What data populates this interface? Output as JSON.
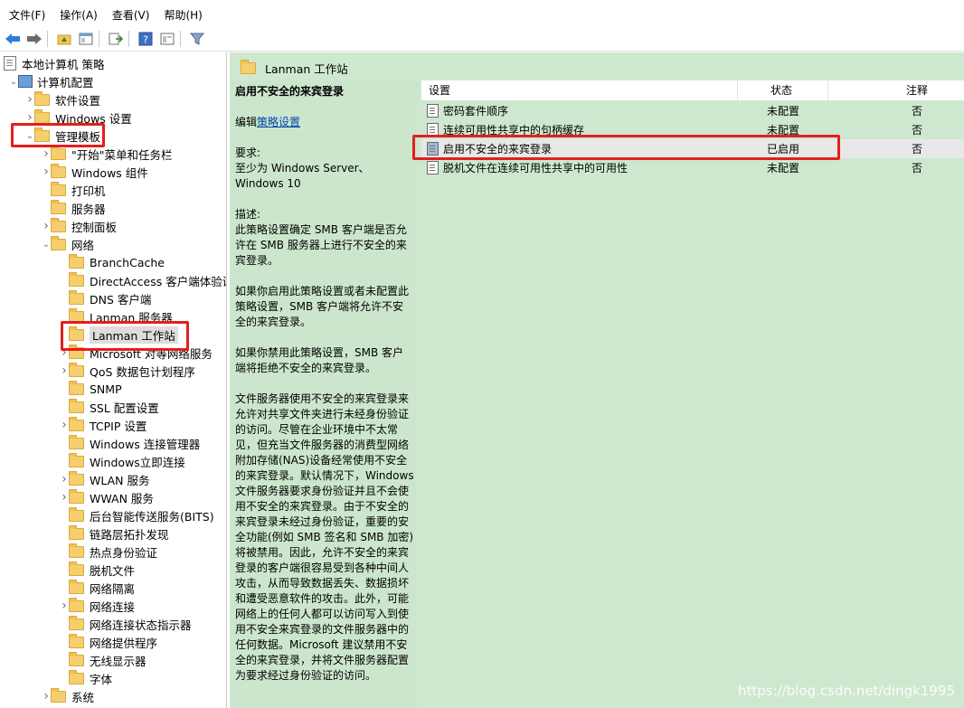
{
  "menu": [
    {
      "label": "文件(F)"
    },
    {
      "label": "操作(A)"
    },
    {
      "label": "查看(V)"
    },
    {
      "label": "帮助(H)"
    }
  ],
  "toolbar": [
    {
      "icon": "back-arrow-icon"
    },
    {
      "icon": "forward-arrow-icon"
    },
    {
      "icon": "up-folder-icon"
    },
    {
      "icon": "show-tree-icon"
    },
    {
      "icon": "export-list-icon"
    },
    {
      "icon": "help-icon"
    },
    {
      "icon": "properties-icon"
    },
    {
      "icon": "filter-icon"
    }
  ],
  "tree": {
    "items": [
      {
        "label": "本地计算机 策略",
        "level": 0,
        "arrow": "",
        "icon": "doc"
      },
      {
        "label": "计算机配置",
        "level": 1,
        "arrow": "down",
        "icon": "computer"
      },
      {
        "label": "软件设置",
        "level": 2,
        "arrow": "right",
        "icon": "folder"
      },
      {
        "label": "Windows 设置",
        "level": 2,
        "arrow": "right",
        "icon": "folder"
      },
      {
        "label": "管理模板",
        "level": 2,
        "arrow": "down",
        "icon": "folder"
      },
      {
        "label": "\"开始\"菜单和任务栏",
        "level": 3,
        "arrow": "right",
        "icon": "folder"
      },
      {
        "label": "Windows 组件",
        "level": 3,
        "arrow": "right",
        "icon": "folder"
      },
      {
        "label": "打印机",
        "level": 3,
        "arrow": "",
        "icon": "folder"
      },
      {
        "label": "服务器",
        "level": 3,
        "arrow": "",
        "icon": "folder"
      },
      {
        "label": "控制面板",
        "level": 3,
        "arrow": "right",
        "icon": "folder"
      },
      {
        "label": "网络",
        "level": 3,
        "arrow": "down",
        "icon": "folder"
      },
      {
        "label": "BranchCache",
        "level": 4,
        "arrow": "",
        "icon": "folder"
      },
      {
        "label": "DirectAccess 客户端体验设置",
        "level": 4,
        "arrow": "",
        "icon": "folder"
      },
      {
        "label": "DNS 客户端",
        "level": 4,
        "arrow": "",
        "icon": "folder"
      },
      {
        "label": "Lanman 服务器",
        "level": 4,
        "arrow": "",
        "icon": "folder"
      },
      {
        "label": "Lanman 工作站",
        "level": 4,
        "arrow": "",
        "icon": "folder",
        "selected": true
      },
      {
        "label": "Microsoft 对等网络服务",
        "level": 4,
        "arrow": "right",
        "icon": "folder"
      },
      {
        "label": "QoS 数据包计划程序",
        "level": 4,
        "arrow": "right",
        "icon": "folder"
      },
      {
        "label": "SNMP",
        "level": 4,
        "arrow": "",
        "icon": "folder"
      },
      {
        "label": "SSL 配置设置",
        "level": 4,
        "arrow": "",
        "icon": "folder"
      },
      {
        "label": "TCPIP 设置",
        "level": 4,
        "arrow": "right",
        "icon": "folder"
      },
      {
        "label": "Windows 连接管理器",
        "level": 4,
        "arrow": "",
        "icon": "folder"
      },
      {
        "label": "Windows立即连接",
        "level": 4,
        "arrow": "",
        "icon": "folder"
      },
      {
        "label": "WLAN 服务",
        "level": 4,
        "arrow": "right",
        "icon": "folder"
      },
      {
        "label": "WWAN 服务",
        "level": 4,
        "arrow": "right",
        "icon": "folder"
      },
      {
        "label": "后台智能传送服务(BITS)",
        "level": 4,
        "arrow": "",
        "icon": "folder"
      },
      {
        "label": "链路层拓扑发现",
        "level": 4,
        "arrow": "",
        "icon": "folder"
      },
      {
        "label": "热点身份验证",
        "level": 4,
        "arrow": "",
        "icon": "folder"
      },
      {
        "label": "脱机文件",
        "level": 4,
        "arrow": "",
        "icon": "folder"
      },
      {
        "label": "网络隔离",
        "level": 4,
        "arrow": "",
        "icon": "folder"
      },
      {
        "label": "网络连接",
        "level": 4,
        "arrow": "right",
        "icon": "folder"
      },
      {
        "label": "网络连接状态指示器",
        "level": 4,
        "arrow": "",
        "icon": "folder"
      },
      {
        "label": "网络提供程序",
        "level": 4,
        "arrow": "",
        "icon": "folder"
      },
      {
        "label": "无线显示器",
        "level": 4,
        "arrow": "",
        "icon": "folder"
      },
      {
        "label": "字体",
        "level": 4,
        "arrow": "",
        "icon": "folder"
      },
      {
        "label": "系统",
        "level": 3,
        "arrow": "right",
        "icon": "folder"
      }
    ]
  },
  "pane": {
    "title": "Lanman 工作站"
  },
  "description": {
    "title": "启用不安全的来宾登录",
    "edit_prefix": "编辑",
    "edit_link": "策略设置",
    "requirements_label": "要求:",
    "requirements_text": "至少为 Windows Server、Windows 10",
    "desc_label": "描述:",
    "para1": "此策略设置确定 SMB 客户端是否允许在 SMB 服务器上进行不安全的来宾登录。",
    "para2": "如果你启用此策略设置或者未配置此策略设置，SMB 客户端将允许不安全的来宾登录。",
    "para3": "如果你禁用此策略设置，SMB 客户端将拒绝不安全的来宾登录。",
    "para4": "文件服务器使用不安全的来宾登录来允许对共享文件夹进行未经身份验证的访问。尽管在企业环境中不太常见，但充当文件服务器的消费型网络附加存储(NAS)设备经常使用不安全的来宾登录。默认情况下，Windows 文件服务器要求身份验证并且不会使用不安全的来宾登录。由于不安全的来宾登录未经过身份验证，重要的安全功能(例如 SMB 签名和 SMB 加密)将被禁用。因此，允许不安全的来宾登录的客户端很容易受到各种中间人攻击，从而导致数据丢失、数据损坏和遭受恶意软件的攻击。此外，可能网络上的任何人都可以访问写入到使用不安全来宾登录的文件服务器中的任何数据。Microsoft 建议禁用不安全的来宾登录，并将文件服务器配置为要求经过身份验证的访问。"
  },
  "list": {
    "headers": {
      "setting": "设置",
      "state": "状态",
      "comment": "注释"
    },
    "rows": [
      {
        "name": "密码套件顺序",
        "state": "未配置",
        "comment": "否",
        "enabled": false
      },
      {
        "name": "连续可用性共享中的句柄缓存",
        "state": "未配置",
        "comment": "否",
        "enabled": false
      },
      {
        "name": "启用不安全的来宾登录",
        "state": "已启用",
        "comment": "否",
        "enabled": true
      },
      {
        "name": "脱机文件在连续可用性共享中的可用性",
        "state": "未配置",
        "comment": "否",
        "enabled": false
      }
    ]
  },
  "watermark": "https://blog.csdn.net/dingk1995",
  "colors": {
    "highlight_box": "#e41e1e",
    "pane_bg": "#cde8cf",
    "link": "#0645ad"
  }
}
